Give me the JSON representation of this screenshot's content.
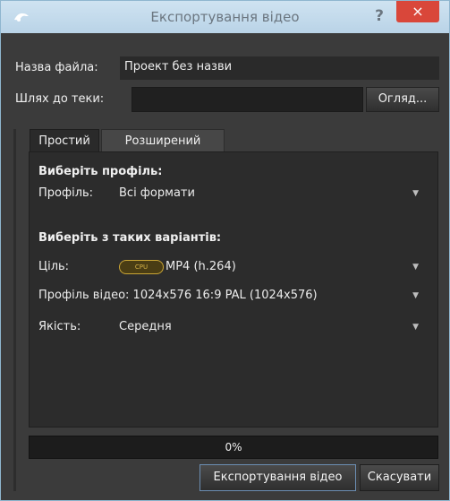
{
  "window": {
    "title": "Експортування відео",
    "help_label": "?",
    "close_label": "×"
  },
  "form": {
    "filename_label": "Назва файла:",
    "filename_value": "Проект без назви",
    "folder_label": "Шлях до теки:",
    "folder_value": "",
    "browse_label": "Огляд..."
  },
  "tabs": [
    {
      "label": "Простий",
      "active": true
    },
    {
      "label": "Розширений",
      "active": false
    }
  ],
  "simple": {
    "profile_section": "Виберіть профіль:",
    "profile_label": "Профіль:",
    "profile_value": "Всі формати",
    "options_section": "Виберіть з таких варіантів:",
    "target_label": "Ціль:",
    "target_badge": "CPU",
    "target_value": "MP4 (h.264)",
    "video_profile_label": "Профіль відео:",
    "video_profile_value": "1024x576 16:9 PAL (1024x576)",
    "quality_label": "Якість:",
    "quality_value": "Середня"
  },
  "progress": {
    "value": 0,
    "text": "0%"
  },
  "buttons": {
    "export_label": "Експортування відео",
    "cancel_label": "Скасувати"
  },
  "colors": {
    "titlebar": "#c4dcee",
    "close": "#d9473a",
    "background": "#3b3b3b",
    "badge": "#c9a535"
  }
}
